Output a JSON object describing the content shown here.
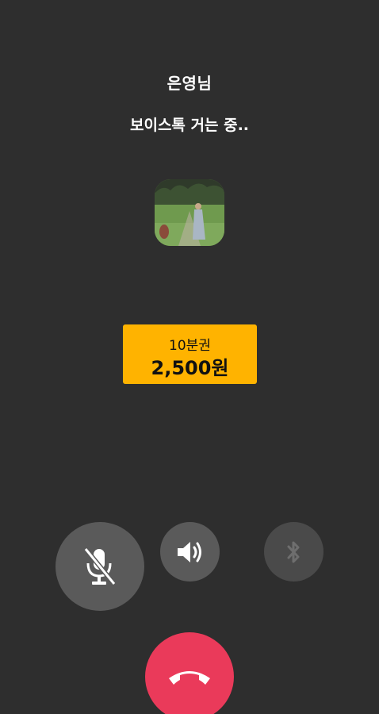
{
  "caller": {
    "name": "은영님",
    "status": "보이스톡 거는 중.."
  },
  "price": {
    "plan": "10분권",
    "amount": "2,500원"
  },
  "icons": {
    "mute": "microphone-off-icon",
    "speaker": "speaker-icon",
    "bluetooth": "bluetooth-icon",
    "hangup": "phone-hangup-icon"
  },
  "colors": {
    "background": "#2e2e2e",
    "price_card": "#ffb300",
    "control_button": "#5a5a5a",
    "disabled_button": "#4a4a4a",
    "hangup": "#ea3a5a"
  }
}
